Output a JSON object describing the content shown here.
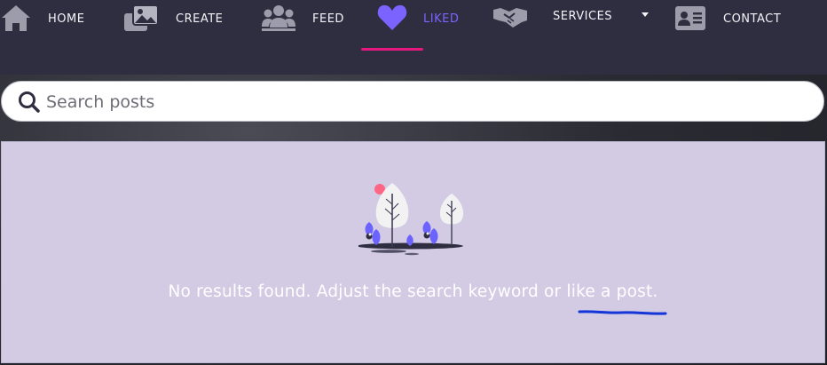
{
  "nav": {
    "items": [
      {
        "label": "home",
        "icon": "home-icon"
      },
      {
        "label": "create",
        "icon": "images-icon"
      },
      {
        "label": "feed",
        "icon": "users-icon"
      },
      {
        "label": "liked",
        "icon": "heart-icon",
        "active": true
      },
      {
        "label": "",
        "icon": "handshake-icon"
      },
      {
        "label": "services",
        "icon": "caret-down-icon"
      },
      {
        "label": "contact",
        "icon": "contact-card-icon"
      }
    ],
    "active_color": "#7b63ff",
    "underline_color": "#e6177e"
  },
  "search": {
    "placeholder": "Search posts",
    "value": ""
  },
  "results": {
    "empty_message": "No results found. Adjust the search keyword or like a post.",
    "panel_color": "#d2cbe3"
  }
}
